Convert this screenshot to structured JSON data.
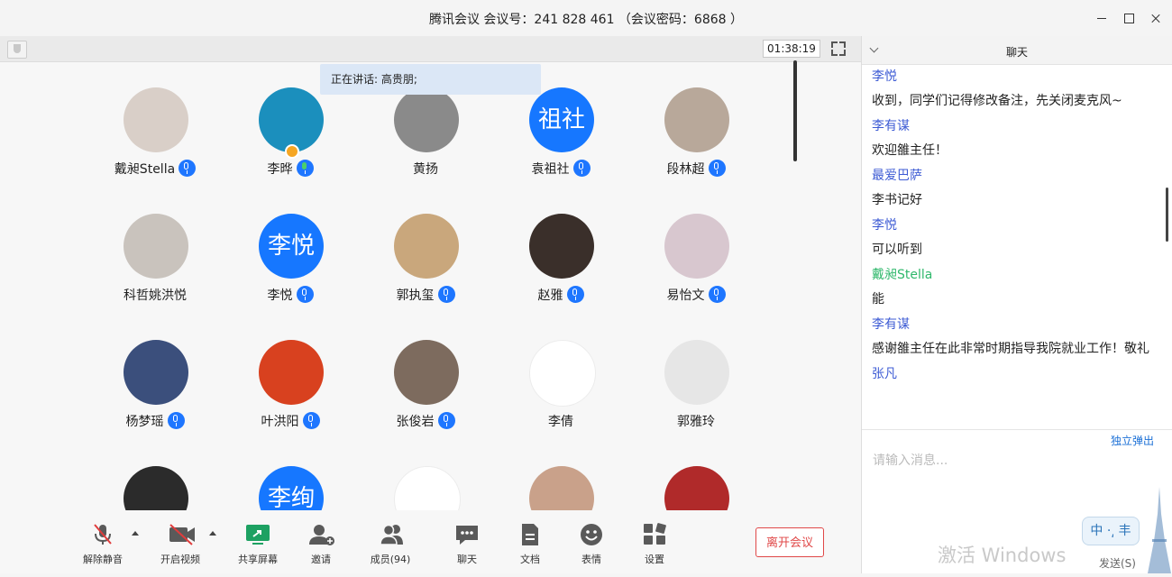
{
  "window": {
    "title": "腾讯会议 会议号：241 828 461 （会议密码：6868 ）"
  },
  "video_toolbar": {
    "timer": "01:38:19"
  },
  "speaking_banner": "正在讲话: 高贵朋;",
  "participants": [
    {
      "name": "戴昶Stella",
      "avatar_type": "photo",
      "avatar_color": "#d9cfc8",
      "mic": "on"
    },
    {
      "name": "李晔",
      "avatar_type": "photo",
      "avatar_color": "#1b8fbd",
      "mic": "speaking",
      "host_badge": true
    },
    {
      "name": "黄扬",
      "avatar_type": "photo",
      "avatar_color": "#8a8a8a",
      "mic": "none"
    },
    {
      "name": "袁祖社",
      "avatar_type": "text",
      "avatar_text": "祖社",
      "mic": "on"
    },
    {
      "name": "段林超",
      "avatar_type": "photo",
      "avatar_color": "#b8a89a",
      "mic": "on"
    },
    {
      "name": "科哲姚洪悦",
      "avatar_type": "photo",
      "avatar_color": "#c9c3bd",
      "mic": "none"
    },
    {
      "name": "李悦",
      "avatar_type": "text",
      "avatar_text": "李悦",
      "mic": "on"
    },
    {
      "name": "郭执玺",
      "avatar_type": "photo",
      "avatar_color": "#c9a77c",
      "mic": "on"
    },
    {
      "name": "赵雅",
      "avatar_type": "photo",
      "avatar_color": "#3a2f2a",
      "mic": "on"
    },
    {
      "name": "易怡文",
      "avatar_type": "photo",
      "avatar_color": "#d8c7cf",
      "mic": "on"
    },
    {
      "name": "杨梦瑶",
      "avatar_type": "photo",
      "avatar_color": "#3b4f7c",
      "mic": "on"
    },
    {
      "name": "叶洪阳",
      "avatar_type": "photo",
      "avatar_color": "#d8411f",
      "mic": "on"
    },
    {
      "name": "张俊岩",
      "avatar_type": "photo",
      "avatar_color": "#7d6b5e",
      "mic": "on"
    },
    {
      "name": "李倩",
      "avatar_type": "photo",
      "avatar_color": "#ffffff",
      "mic": "none"
    },
    {
      "name": "郭雅玲",
      "avatar_type": "photo",
      "avatar_color": "#e6e6e6",
      "mic": "none"
    },
    {
      "name": "",
      "avatar_type": "photo",
      "avatar_color": "#2b2b2b",
      "mic": "none"
    },
    {
      "name": "",
      "avatar_type": "text",
      "avatar_text": "李绚",
      "mic": "none"
    },
    {
      "name": "",
      "avatar_type": "photo",
      "avatar_color": "#ffffff",
      "mic": "none"
    },
    {
      "name": "",
      "avatar_type": "photo",
      "avatar_color": "#c9a18a",
      "mic": "none"
    },
    {
      "name": "",
      "avatar_type": "photo",
      "avatar_color": "#b02a2a",
      "mic": "none"
    }
  ],
  "controls": {
    "unmute": "解除静音",
    "start_video": "开启视频",
    "share_screen": "共享屏幕",
    "invite": "邀请",
    "members": "成员(94)",
    "chat": "聊天",
    "docs": "文档",
    "reactions": "表情",
    "settings": "设置",
    "leave": "离开会议"
  },
  "chat": {
    "title": "聊天",
    "messages": [
      {
        "sender": "李悦",
        "text": "收到，同学们记得修改备注，先关闭麦克风~"
      },
      {
        "sender": "李有谋",
        "text": "欢迎雒主任！"
      },
      {
        "sender": "最爱巴萨",
        "text": "李书记好"
      },
      {
        "sender": "李悦",
        "text": "可以听到"
      },
      {
        "sender": "戴昶Stella",
        "text": "能",
        "sender_color": "green"
      },
      {
        "sender": "李有谋",
        "text": "感谢雒主任在此非常时期指导我院就业工作！敬礼"
      },
      {
        "sender": "张凡",
        "text": ""
      }
    ],
    "popout": "独立弹出",
    "input_placeholder": "请输入消息...",
    "send_label": "发送(S)",
    "ime_label": "中 ·͵ 丰",
    "watermark": "激活 Windows"
  },
  "colors": {
    "accent_blue": "#1677ff",
    "chat_sender": "#3d5bd4",
    "chat_sender_green": "#2fb86b",
    "leave_red": "#e04848"
  }
}
